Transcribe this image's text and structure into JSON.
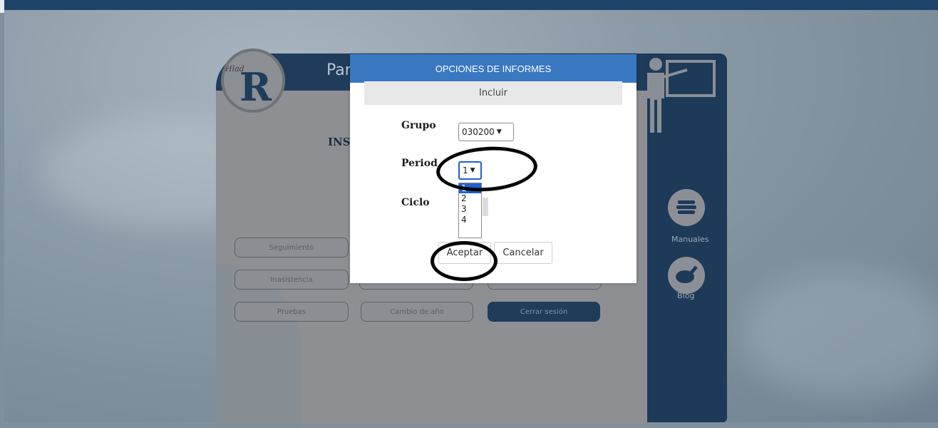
{
  "background": {
    "app_header_title": "Par",
    "institution_text": "INST",
    "logo_text": "Hlad"
  },
  "menu": {
    "buttons": [
      {
        "label": "Seguimiento"
      },
      {
        "label": "Inasistencia"
      },
      {
        "label": "Pruebas"
      },
      {
        "label": "Cambio de año"
      },
      {
        "label": "Cerrar sesión"
      }
    ]
  },
  "sidebar": {
    "manuals_label": "Manuales",
    "blog_label": "Blog"
  },
  "modal": {
    "title": "OPCIONES DE INFORMES",
    "subtitle": "Incluir",
    "group_label": "Grupo",
    "group_value": "030200",
    "period_label": "Period",
    "period_value": "1",
    "period_options": [
      "1",
      "2",
      "3",
      "4"
    ],
    "cycle_label": "Ciclo",
    "accept_label": "Aceptar",
    "cancel_label": "Cancelar"
  },
  "colors": {
    "modal_header": "#3a78c2",
    "dark_navy": "#1f3c5b",
    "annotation_ring": "#050505",
    "selected_option": "#1f60cc"
  }
}
